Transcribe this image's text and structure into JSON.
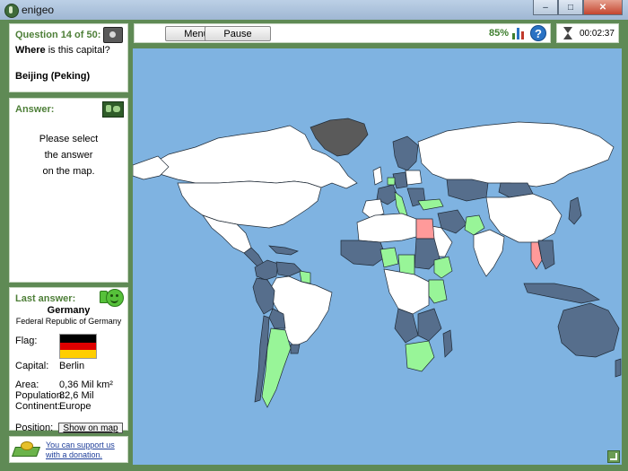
{
  "window": {
    "title": "enigeo"
  },
  "question": {
    "header": "Question 14 of 50:",
    "where": "Where",
    "text": "is this capital?",
    "capital": "Beijing (Peking)"
  },
  "answer": {
    "header": "Answer:",
    "prompt": [
      "Please select",
      "the answer",
      "on the map."
    ]
  },
  "last_answer": {
    "header": "Last answer:",
    "country": "Germany",
    "official_name": "Federal Republic of Germany",
    "flag_label": "Flag:",
    "flag_colors": [
      "#000000",
      "#dd0000",
      "#ffce00"
    ],
    "capital_label": "Capital:",
    "capital": "Berlin",
    "area_label": "Area:",
    "area": "0,36 Mil km²",
    "population_label": "Population:",
    "population": "82,6 Mil",
    "continent_label": "Continent:",
    "continent": "Europe",
    "position_label": "Position:",
    "show_button": "Show on map"
  },
  "donate": {
    "line1": "You can support us",
    "line2": "with a donation."
  },
  "toolbar": {
    "menu": "Menu",
    "pause": "Pause",
    "score": "85%"
  },
  "timer": {
    "elapsed": "00:02:37"
  },
  "map_colors": {
    "ocean": "#7fb3e1",
    "unanswered": "#ffffff",
    "correct": "#98f598",
    "answered": "#566e8c",
    "wrong": "#ff9a9a",
    "greenland": "#5a5a5a"
  }
}
